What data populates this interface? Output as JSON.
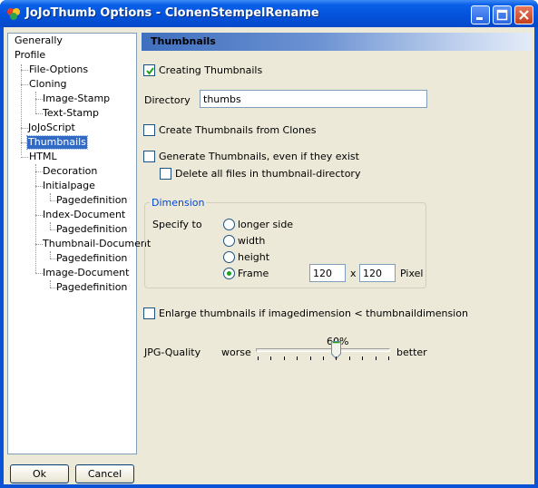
{
  "window": {
    "title": "JoJoThumb Options - ClonenStempelRename"
  },
  "tree": {
    "items": [
      {
        "label": "Generally"
      },
      {
        "label": "Profile"
      },
      {
        "label": "File-Options"
      },
      {
        "label": "Cloning"
      },
      {
        "label": "Image-Stamp"
      },
      {
        "label": "Text-Stamp"
      },
      {
        "label": "JoJoScript"
      },
      {
        "label": "Thumbnails",
        "selected": true
      },
      {
        "label": "HTML"
      },
      {
        "label": "Decoration"
      },
      {
        "label": "Initialpage"
      },
      {
        "label": "Pagedefinition"
      },
      {
        "label": "Index-Document"
      },
      {
        "label": "Pagedefinition"
      },
      {
        "label": "Thumbnail-Document"
      },
      {
        "label": "Pagedefinition"
      },
      {
        "label": "Image-Document"
      },
      {
        "label": "Pagedefinition"
      }
    ]
  },
  "buttons": {
    "ok": "Ok",
    "cancel": "Cancel"
  },
  "panel": {
    "title": "Thumbnails",
    "creating_thumbnails": {
      "label": "Creating Thumbnails",
      "checked": true
    },
    "directory": {
      "label": "Directory",
      "value": "thumbs"
    },
    "from_clones": {
      "label": "Create Thumbnails from Clones",
      "checked": false
    },
    "generate_existing": {
      "label": "Generate Thumbnails, even if they exist",
      "checked": false
    },
    "delete_all": {
      "label": "Delete all files in thumbnail-directory",
      "checked": false
    },
    "dimension": {
      "title": "Dimension",
      "specify_label": "Specify to",
      "options": [
        {
          "label": "longer side",
          "selected": false
        },
        {
          "label": "width",
          "selected": false
        },
        {
          "label": "height",
          "selected": false
        },
        {
          "label": "Frame",
          "selected": true
        }
      ],
      "frame_width": "120",
      "frame_sep": "x",
      "frame_height": "120",
      "unit": "Pixel"
    },
    "enlarge": {
      "label": "Enlarge thumbnails if imagedimension < thumbnaildimension",
      "checked": false
    },
    "jpg_quality": {
      "label": "JPG-Quality",
      "min_label": "worse",
      "max_label": "better",
      "value_text": "60%",
      "value": 60
    }
  },
  "colors": {
    "selection": "#316ac5",
    "titlebar": "#0453dc",
    "dialog": "#ece9d8"
  }
}
